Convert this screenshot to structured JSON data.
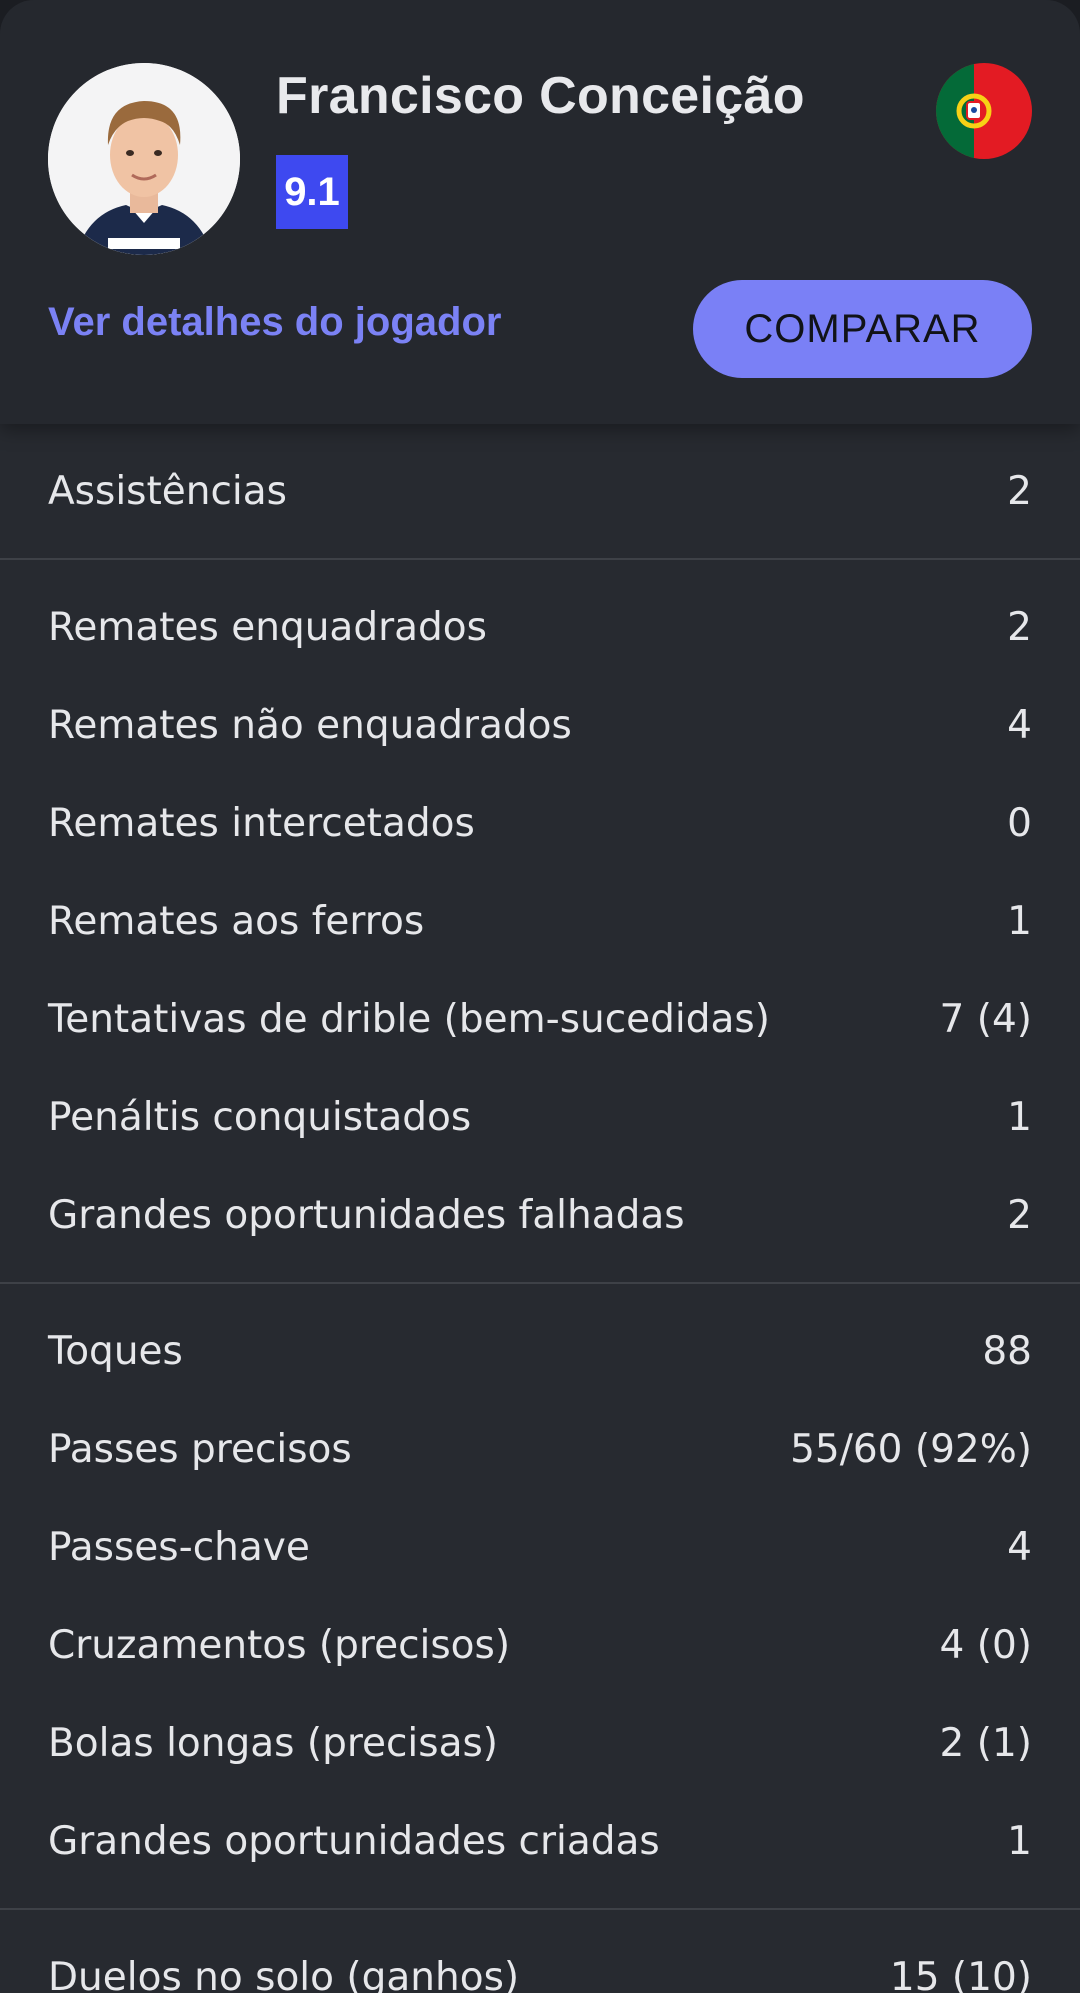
{
  "player": {
    "name": "Francisco Conceição",
    "rating": "9.1",
    "avatar": "player-photo",
    "flag": "portugal-flag"
  },
  "actions": {
    "details_link": "Ver detalhes do jogador",
    "compare_label": "COMPARAR"
  },
  "colors": {
    "accent": "#7a80f6",
    "rating_badge": "#3e49f0",
    "background": "#272a30"
  },
  "groups": [
    [
      {
        "label": "Assistências",
        "value": "2"
      }
    ],
    [
      {
        "label": "Remates enquadrados",
        "value": "2"
      },
      {
        "label": "Remates não enquadrados",
        "value": "4"
      },
      {
        "label": "Remates intercetados",
        "value": "0"
      },
      {
        "label": "Remates aos ferros",
        "value": "1"
      },
      {
        "label": "Tentativas de drible (bem-sucedidas)",
        "value": "7 (4)"
      },
      {
        "label": "Penáltis conquistados",
        "value": "1"
      },
      {
        "label": "Grandes oportunidades falhadas",
        "value": "2"
      }
    ],
    [
      {
        "label": "Toques",
        "value": "88"
      },
      {
        "label": "Passes precisos",
        "value": "55/60 (92%)"
      },
      {
        "label": "Passes-chave",
        "value": "4"
      },
      {
        "label": "Cruzamentos (precisos)",
        "value": "4 (0)"
      },
      {
        "label": "Bolas longas (precisas)",
        "value": "2 (1)"
      },
      {
        "label": "Grandes oportunidades criadas",
        "value": "1"
      }
    ],
    [
      {
        "label": "Duelos no solo (ganhos)",
        "value": "15 (10)"
      }
    ]
  ]
}
